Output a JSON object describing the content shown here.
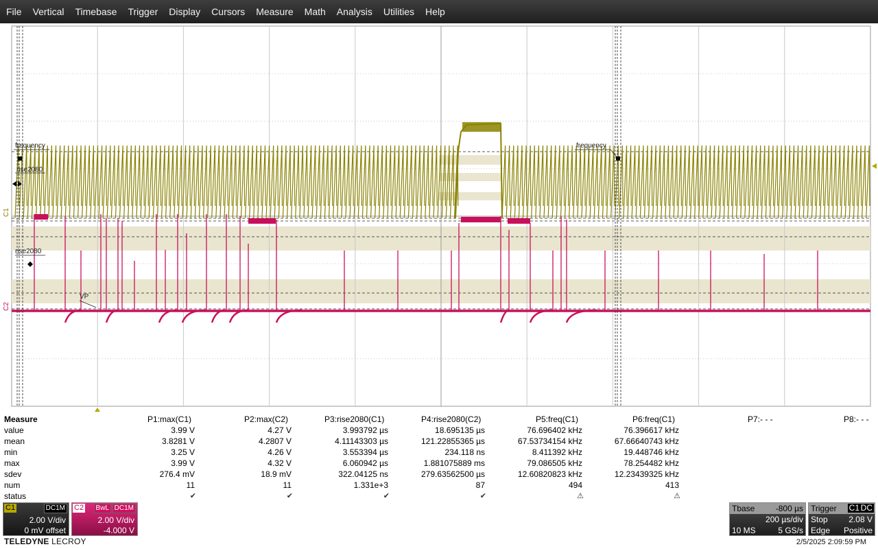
{
  "menu": [
    "File",
    "Vertical",
    "Timebase",
    "Trigger",
    "Display",
    "Cursors",
    "Measure",
    "Math",
    "Analysis",
    "Utilities",
    "Help"
  ],
  "channel_markers": {
    "c1": "C1",
    "c2": "C2"
  },
  "trace_labels": {
    "freq_left": "frequency",
    "rise_top": "rise2080",
    "rise_left": "rise2080",
    "vp": "VP",
    "freq_right": "frequency"
  },
  "colors": {
    "c1": "#8a8200",
    "c2": "#c8105c",
    "grid": "#c8c8c8",
    "band": "#e9e5cf"
  },
  "measure": {
    "title": "Measure",
    "headers": [
      "P1:max(C1)",
      "P2:max(C2)",
      "P3:rise2080(C1)",
      "P4:rise2080(C2)",
      "P5:freq(C1)",
      "P6:freq(C1)",
      "P7:- - -",
      "P8:- - -"
    ],
    "rows": [
      {
        "label": "value",
        "values": [
          "3.99 V",
          "4.27 V",
          "3.993792 µs",
          "18.695135 µs",
          "76.696402 kHz",
          "76.396617 kHz"
        ]
      },
      {
        "label": "mean",
        "values": [
          "3.8281 V",
          "4.2807 V",
          "4.11143303 µs",
          "121.22855365 µs",
          "67.53734154 kHz",
          "67.66640743 kHz"
        ]
      },
      {
        "label": "min",
        "values": [
          "3.25 V",
          "4.26 V",
          "3.553394 µs",
          "234.118 ns",
          "8.411392 kHz",
          "19.448746 kHz"
        ]
      },
      {
        "label": "max",
        "values": [
          "3.99 V",
          "4.32 V",
          "6.060942 µs",
          "1.881075889 ms",
          "79.086505 kHz",
          "78.254482 kHz"
        ]
      },
      {
        "label": "sdev",
        "values": [
          "276.4 mV",
          "18.9 mV",
          "322.04125 ns",
          "279.63562500 µs",
          "12.60820823 kHz",
          "12.23439325 kHz"
        ]
      },
      {
        "label": "num",
        "values": [
          "11",
          "11",
          "1.331e+3",
          "87",
          "494",
          "413"
        ]
      },
      {
        "label": "status",
        "values": [
          "✔",
          "✔",
          "✔",
          "✔",
          "⚠",
          "⚠"
        ]
      }
    ]
  },
  "c1": {
    "tag": "C1",
    "coupling": "DC1M",
    "vdiv": "2.00 V/div",
    "offset": "0 mV offset"
  },
  "c2": {
    "tag": "C2",
    "bwl": "BwL",
    "coupling": "DC1M",
    "vdiv": "2.00 V/div",
    "offset": "-4.000 V"
  },
  "timebase": {
    "label": "Tbase",
    "delay": "-800 µs",
    "tdiv": "200 µs/div",
    "samples": "10 MS",
    "rate": "5 GS/s"
  },
  "trigger": {
    "label": "Trigger",
    "source": "C1",
    "coupling": "DC",
    "mode": "Stop",
    "level": "2.08 V",
    "type": "Edge",
    "slope": "Positive"
  },
  "brand": {
    "bold": "TELEDYNE",
    "normal": " LECROY"
  },
  "timestamp": "2/5/2025 2:09:59 PM"
}
